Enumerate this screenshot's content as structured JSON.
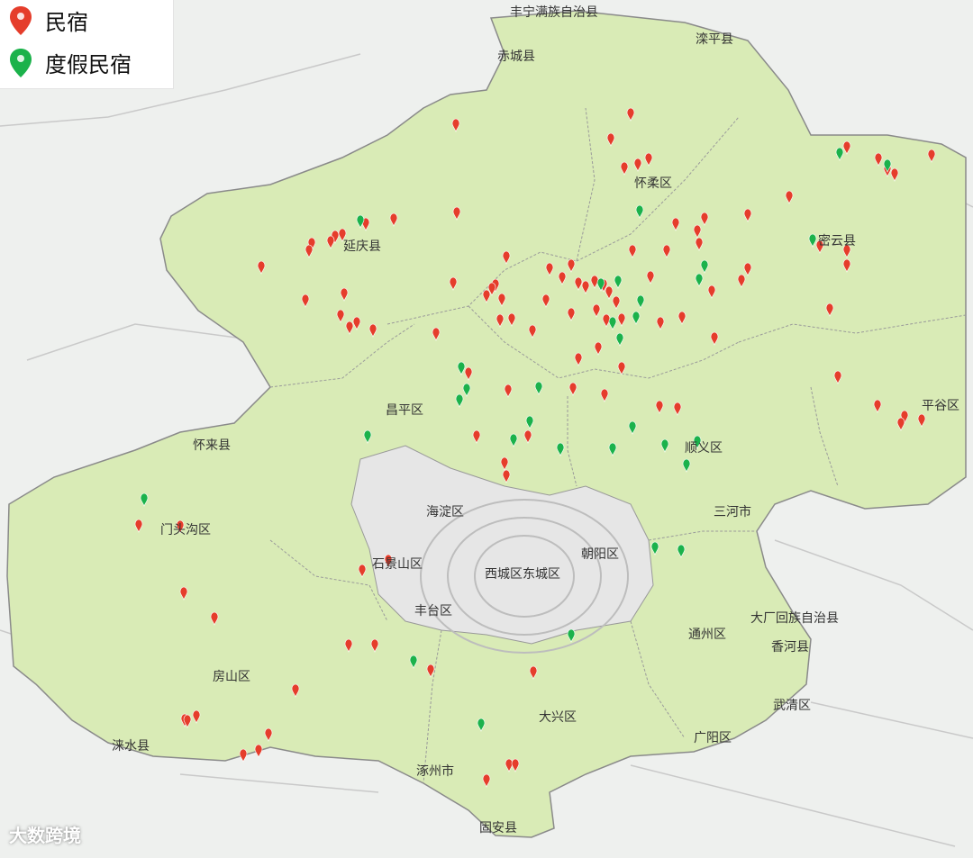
{
  "legend": {
    "items": [
      {
        "label": "民宿",
        "icon": "red-map-pin-icon",
        "color": "#e53d2b"
      },
      {
        "label": "度假民宿",
        "icon": "green-map-pin-icon",
        "color": "#1bb24b"
      }
    ]
  },
  "map": {
    "region_fill": "#d9ebb6",
    "region_border": "#8a8a8a",
    "urban_fill": "#e6e6e6",
    "labels": {
      "fengning": "丰宁满族自治县",
      "chicheng": "赤城县",
      "luanping": "滦平县",
      "huairou": "怀柔区",
      "miyun": "密云县",
      "yanqing": "延庆县",
      "pinggu": "平谷区",
      "changping": "昌平区",
      "huailai": "怀来县",
      "shunyi": "顺义区",
      "mentougou": "门头沟区",
      "haidian": "海淀区",
      "sanhe": "三河市",
      "shijingshan": "石景山区",
      "xicheng_dongcheng": "西城区东城区",
      "chaoyang": "朝阳区",
      "fengtai": "丰台区",
      "dachang": "大厂回族自治县",
      "tongzhou": "通州区",
      "xianghe": "香河县",
      "fangshan": "房山区",
      "daxing": "大兴区",
      "wuqing": "武清区",
      "laishui": "涞水县",
      "guangyang": "广阳区",
      "zhuozhou": "涿州市",
      "gu_an": "固安县"
    }
  },
  "watermark": "大数跨境"
}
